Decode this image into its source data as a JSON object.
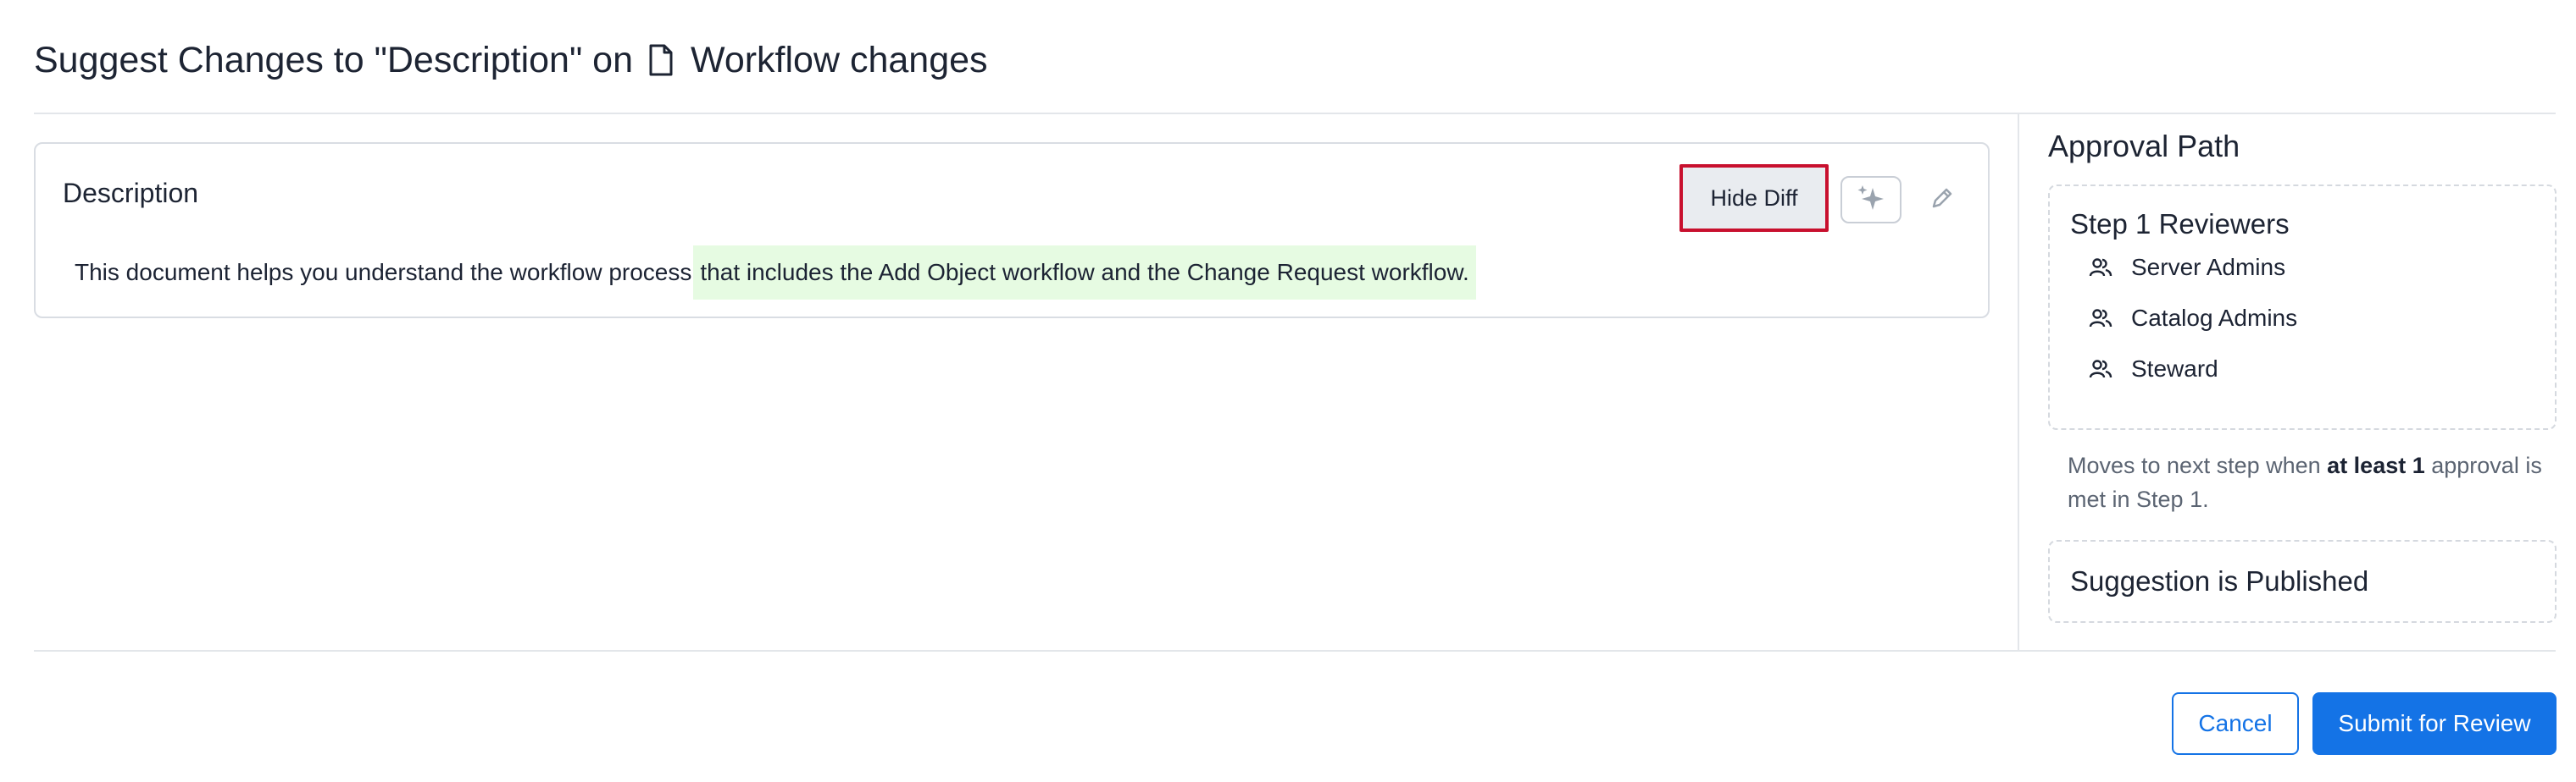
{
  "header": {
    "title_prefix": "Suggest Changes to \"Description\" on",
    "asset_name": "Workflow changes",
    "asset_icon": "document-icon"
  },
  "editor": {
    "heading": "Description",
    "original_text": "This document helps you understand the workflow process",
    "added_text": "that includes the Add Object workflow and the Change Request workflow.",
    "hide_diff_label": "Hide Diff",
    "ai_icon": "sparkle-icon",
    "edit_icon": "pencil-icon",
    "added_highlight_color": "#e6fbe2",
    "focus_outline_color": "#c8102e"
  },
  "approval": {
    "title": "Approval Path",
    "step1": {
      "title": "Step 1 Reviewers",
      "reviewers": [
        {
          "label": "Server Admins",
          "icon": "users-icon"
        },
        {
          "label": "Catalog Admins",
          "icon": "users-icon"
        },
        {
          "label": "Steward",
          "icon": "users-icon"
        }
      ]
    },
    "note": {
      "part1": "Moves to next step when ",
      "bold": "at least 1",
      "part2": " approval is met in Step 1."
    },
    "final_step": "Suggestion is Published"
  },
  "footer": {
    "cancel_label": "Cancel",
    "submit_label": "Submit for Review",
    "accent_color": "#1473e6"
  }
}
